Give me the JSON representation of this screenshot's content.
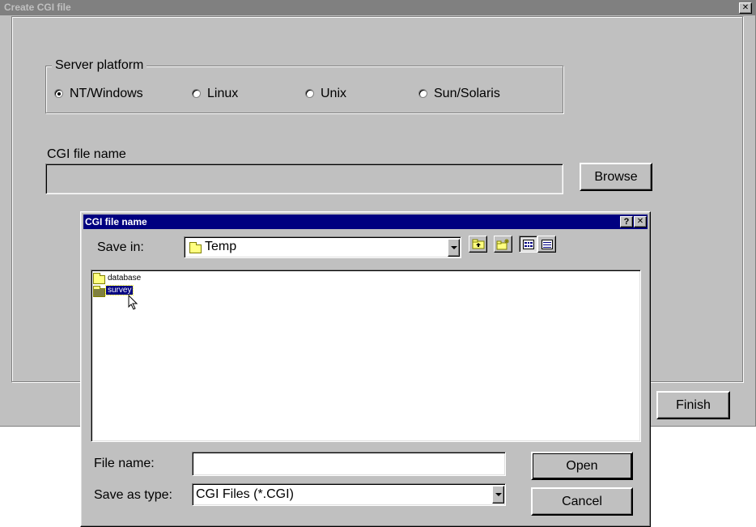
{
  "wizard": {
    "title": "Create CGI file",
    "close_glyph": "✕",
    "platform_group_label": "Server platform",
    "platforms": [
      {
        "label": "NT/Windows",
        "selected": true
      },
      {
        "label": "Linux",
        "selected": false
      },
      {
        "label": "Unix",
        "selected": false
      },
      {
        "label": "Sun/Solaris",
        "selected": false
      }
    ],
    "cgi_name_label": "CGI file name",
    "cgi_name_value": "",
    "browse_label": "Browse",
    "finish_label": "Finish"
  },
  "dialog": {
    "title": "CGI file name",
    "help_glyph": "?",
    "close_glyph": "✕",
    "save_in_label": "Save in:",
    "save_in_value": "Temp",
    "files": [
      {
        "name": "database",
        "type": "folder",
        "selected": false
      },
      {
        "name": "survey",
        "type": "folder",
        "selected": true
      }
    ],
    "file_name_label": "File name:",
    "file_name_value": "",
    "save_as_type_label": "Save as type:",
    "save_as_type_value": "CGI Files (*.CGI)",
    "open_label": "Open",
    "cancel_label": "Cancel"
  },
  "colors": {
    "active_title": "#000080",
    "inactive_title": "#808080",
    "face": "#c0c0c0"
  }
}
